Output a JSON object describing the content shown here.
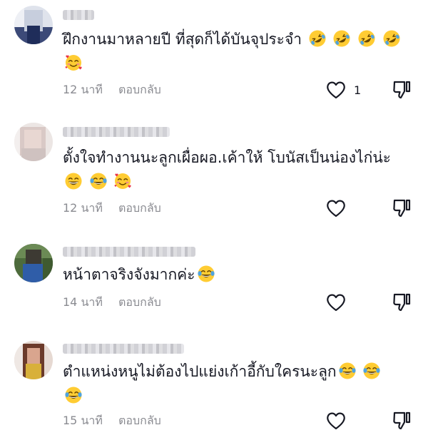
{
  "comments": [
    {
      "text": "ฝึกงานมาหลายปี ที่สุดก็ได้บันจุประจำ",
      "emojis": [
        "rolling-laughing",
        "rolling-laughing",
        "rolling-laughing",
        "rolling-laughing",
        "smiling-hearts"
      ],
      "time": "12 นาที",
      "reply": "ตอบกลับ",
      "likes": "1"
    },
    {
      "text": "ตั้งใจทำงานนะลูกเผื่อผอ.เค้าให้ โบนัสเป็นน่องไก่น่ะ",
      "emojis": [
        "grinning",
        "tears-of-joy",
        "smiling-hearts"
      ],
      "time": "12 นาที",
      "reply": "ตอบกลับ",
      "likes": ""
    },
    {
      "text": "หน้าตาจริงจังมากค่ะ",
      "emojis": [
        "tears-of-joy"
      ],
      "time": "14 นาที",
      "reply": "ตอบกลับ",
      "likes": ""
    },
    {
      "text": "ตำแหน่งหนูไม่ต้องไปแย่งเก้าอี้กับใครนะลูก",
      "emojis": [
        "tears-of-joy",
        "tears-of-joy",
        "tears-of-joy"
      ],
      "time": "15 นาที",
      "reply": "ตอบกลับ",
      "likes": ""
    }
  ],
  "icons": {
    "like": "heart-outline-icon",
    "dislike": "thumbs-down-outline-icon"
  },
  "colors": {
    "text": "#161823",
    "muted": "#8a8b91",
    "emoji_face": "#FFCC33",
    "tears": "#4FA3E0",
    "hearts": "#E8364A"
  }
}
